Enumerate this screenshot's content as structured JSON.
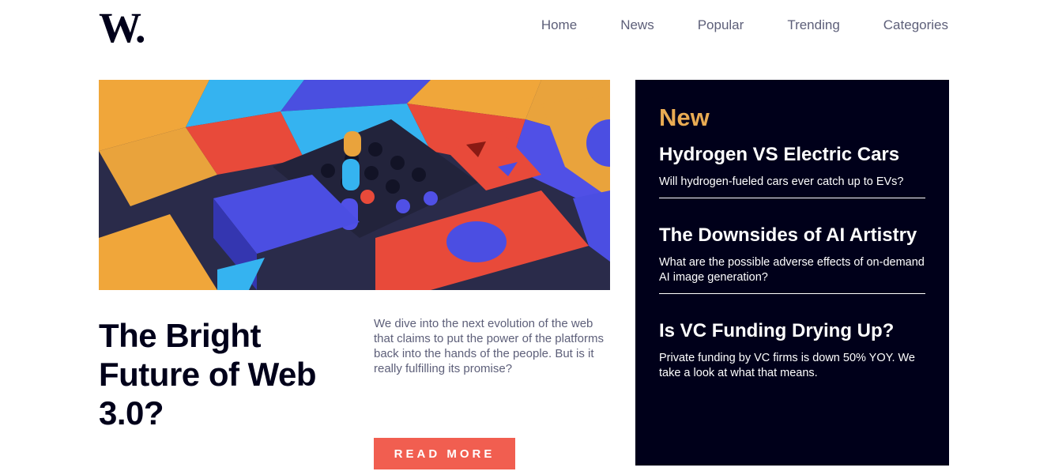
{
  "header": {
    "logo": "W.",
    "nav": [
      "Home",
      "News",
      "Popular",
      "Trending",
      "Categories"
    ]
  },
  "hero": {
    "image": "abstract-3d-blocks-image",
    "title": "The Bright Future of Web 3.0?",
    "summary": "We dive into the next evolution of the web that claims to put the power of the platforms back into the hands of the people. But is it really fulfilling its promise?",
    "cta": "READ MORE"
  },
  "sidebar": {
    "heading": "New",
    "items": [
      {
        "title": "Hydrogen VS Electric Cars",
        "desc": "Will hydrogen-fueled cars ever catch up to EVs?"
      },
      {
        "title": "The Downsides of AI Artistry",
        "desc": "What are the possible adverse effects of on-demand AI image generation?"
      },
      {
        "title": "Is VC Funding Drying Up?",
        "desc": "Private funding by VC firms is down 50% YOY. We take a look at what that means."
      }
    ]
  },
  "colors": {
    "dark_navy": "#00001a",
    "accent_red": "#f15e50",
    "accent_orange": "#e9ab53",
    "grayish_blue": "#5d5f79"
  }
}
